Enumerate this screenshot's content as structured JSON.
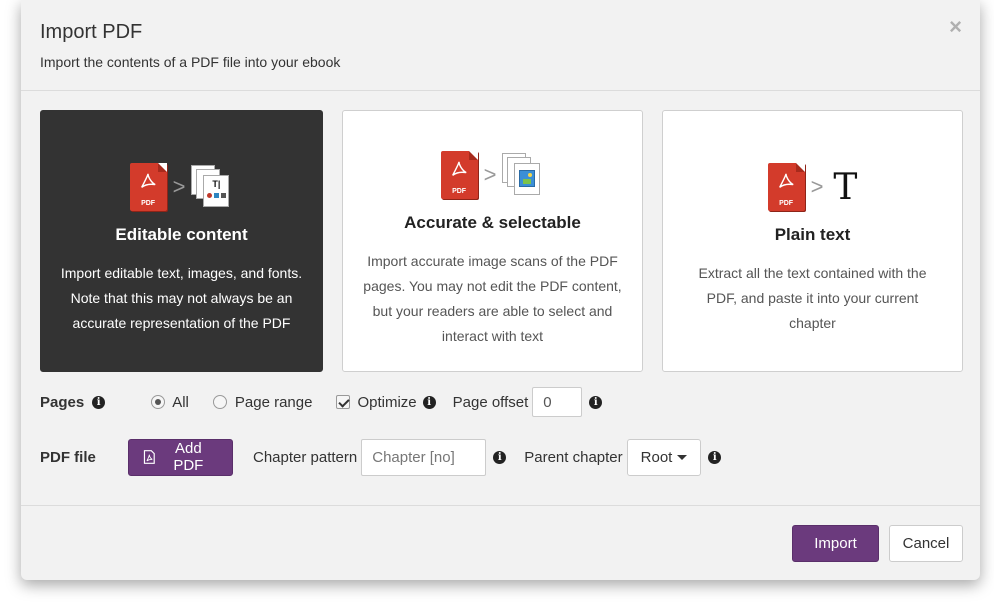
{
  "modal": {
    "title": "Import PDF",
    "subtitle": "Import the contents of a PDF file into your ebook",
    "close_symbol": "×"
  },
  "cards": [
    {
      "title": "Editable content",
      "description": "Import editable text, images, and fonts. Note that this may not always be an accurate representation of the PDF",
      "selected": true,
      "icon": "pdf-to-editable-icon"
    },
    {
      "title": "Accurate & selectable",
      "description": "Import accurate image scans of the PDF pages. You may not edit the PDF content, but your readers are able to select and interact with text",
      "selected": false,
      "icon": "pdf-to-image-icon"
    },
    {
      "title": "Plain text",
      "description": "Extract all the text contained with the PDF, and paste it into your current chapter",
      "selected": false,
      "icon": "pdf-to-text-icon"
    }
  ],
  "pdf_icon_label": "PDF",
  "arrow_symbol": ">",
  "text_glyph": "T",
  "editable_glyph": "T|",
  "pages": {
    "label": "Pages",
    "options": [
      {
        "label": "All",
        "checked": true
      },
      {
        "label": "Page range",
        "checked": false
      }
    ],
    "optimize": {
      "label": "Optimize",
      "checked": true
    },
    "page_offset": {
      "label": "Page offset",
      "value": "0"
    }
  },
  "pdf_file": {
    "label": "PDF file",
    "add_button": "Add PDF",
    "chapter_pattern": {
      "label": "Chapter pattern",
      "placeholder": "Chapter [no]"
    },
    "parent_chapter": {
      "label": "Parent chapter",
      "value": "Root"
    }
  },
  "footer": {
    "import_button": "Import",
    "cancel_button": "Cancel"
  },
  "colors": {
    "accent": "#6b3a7d",
    "selected_card": "#333333",
    "pdf_red": "#d33b2b"
  }
}
